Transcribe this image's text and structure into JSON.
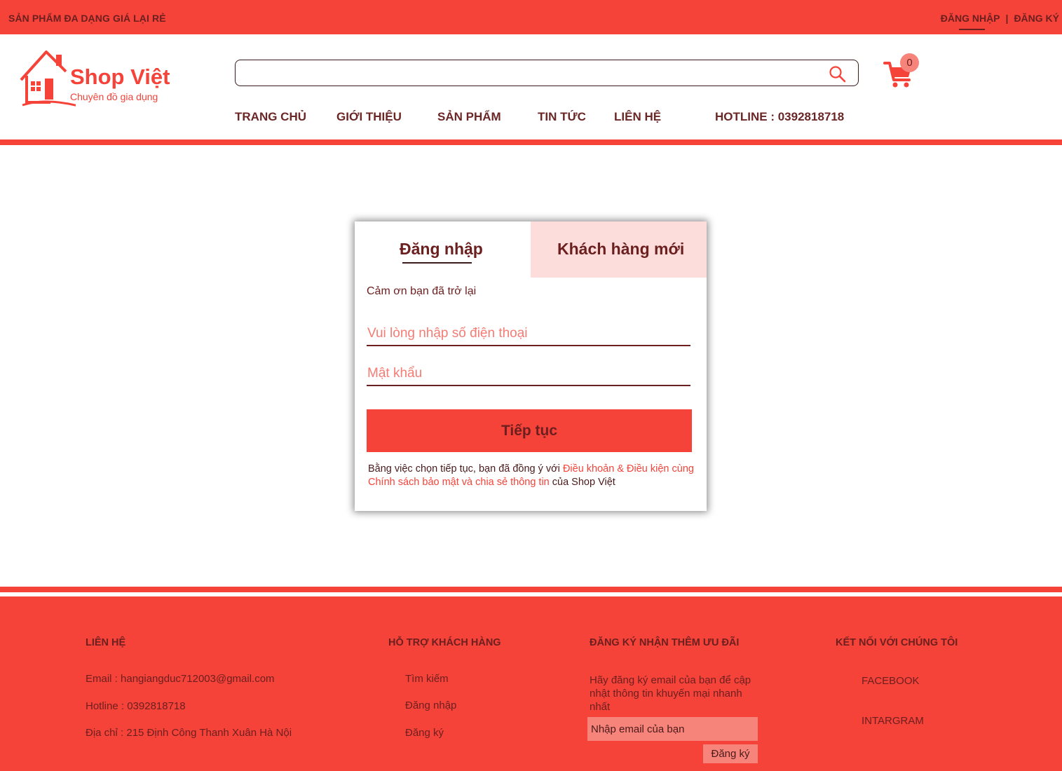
{
  "topbar": {
    "tagline": "SẢN PHẨM ĐA DẠNG GIÁ LẠI RẺ",
    "login": "ĐĂNG NHẬP",
    "separator": "|",
    "register": "ĐĂNG KÝ"
  },
  "header": {
    "brand": "Shop Việt",
    "slogan": "Chuyên đồ gia dụng",
    "search_value": "",
    "cart_count": "0",
    "nav": [
      "TRANG CHỦ",
      "GIỚI THIỆU",
      "SẢN PHẨM",
      "TIN TỨC",
      "LIÊN HỆ"
    ],
    "hotline": "HOTLINE : 0392818718"
  },
  "login_card": {
    "tab_login": "Đăng nhập",
    "tab_new": "Khách hàng mới",
    "welcome": "Cảm ơn bạn đã trở lại",
    "phone_placeholder": "Vui lòng nhập số điện thoại",
    "password_placeholder": "Mật khẩu",
    "continue": "Tiếp tục",
    "terms_prefix": "Bằng việc chọn tiếp tục, bạn đã đồng ý với ",
    "terms_link": "Điều khoản & Điều kiện cùng Chính sách bảo mật và chia sẻ thông tin",
    "terms_suffix": " của Shop Việt"
  },
  "footer": {
    "contact": {
      "heading": "LIÊN HỆ",
      "email": "Email : hangiangduc712003@gmail.com",
      "hotline": "Hotline : 0392818718",
      "address": "Địa chỉ : 215 Định Công Thanh Xuân Hà Nội"
    },
    "support": {
      "heading": "HỖ TRỢ KHÁCH HÀNG",
      "items": [
        "Tìm kiếm",
        "Đăng  nhập",
        "Đăng ký"
      ]
    },
    "newsletter": {
      "heading": "ĐĂNG KÝ NHẬN THÊM ƯU ĐÃI",
      "text": "Hãy đăng ký email của bạn để cập nhật thông tin khuyến mại nhanh nhất",
      "placeholder": "Nhập email của bạn",
      "button": "Đăng ký"
    },
    "social": {
      "heading": "KẾT NỐI VỚI CHÚNG TÔI",
      "items": [
        "FACEBOOK",
        "INTARGRAM"
      ]
    }
  },
  "colors": {
    "primary": "#f5433a",
    "text_dark": "#6b1f1f",
    "tab_bg": "#fddddb",
    "accent_light": "#f7847b"
  }
}
